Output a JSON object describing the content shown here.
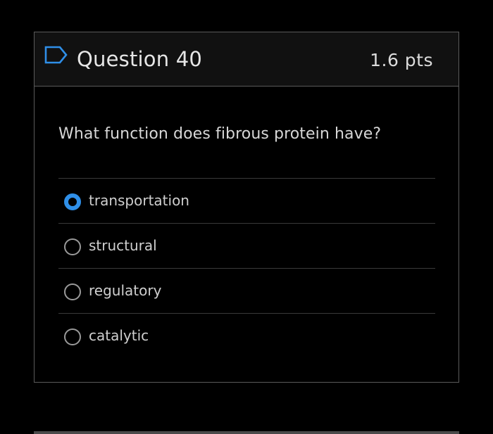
{
  "question": {
    "title": "Question 40",
    "points": "1.6 pts",
    "text": "What function does fibrous protein have?",
    "flag_icon": "bookmark-flag-icon"
  },
  "answers": [
    {
      "label": "transportation",
      "selected": true
    },
    {
      "label": "structural",
      "selected": false
    },
    {
      "label": "regulatory",
      "selected": false
    },
    {
      "label": "catalytic",
      "selected": false
    }
  ],
  "colors": {
    "accent": "#2f8fe8",
    "flag": "#2f8fe8",
    "background": "#000000",
    "border": "#5b5b5b"
  }
}
